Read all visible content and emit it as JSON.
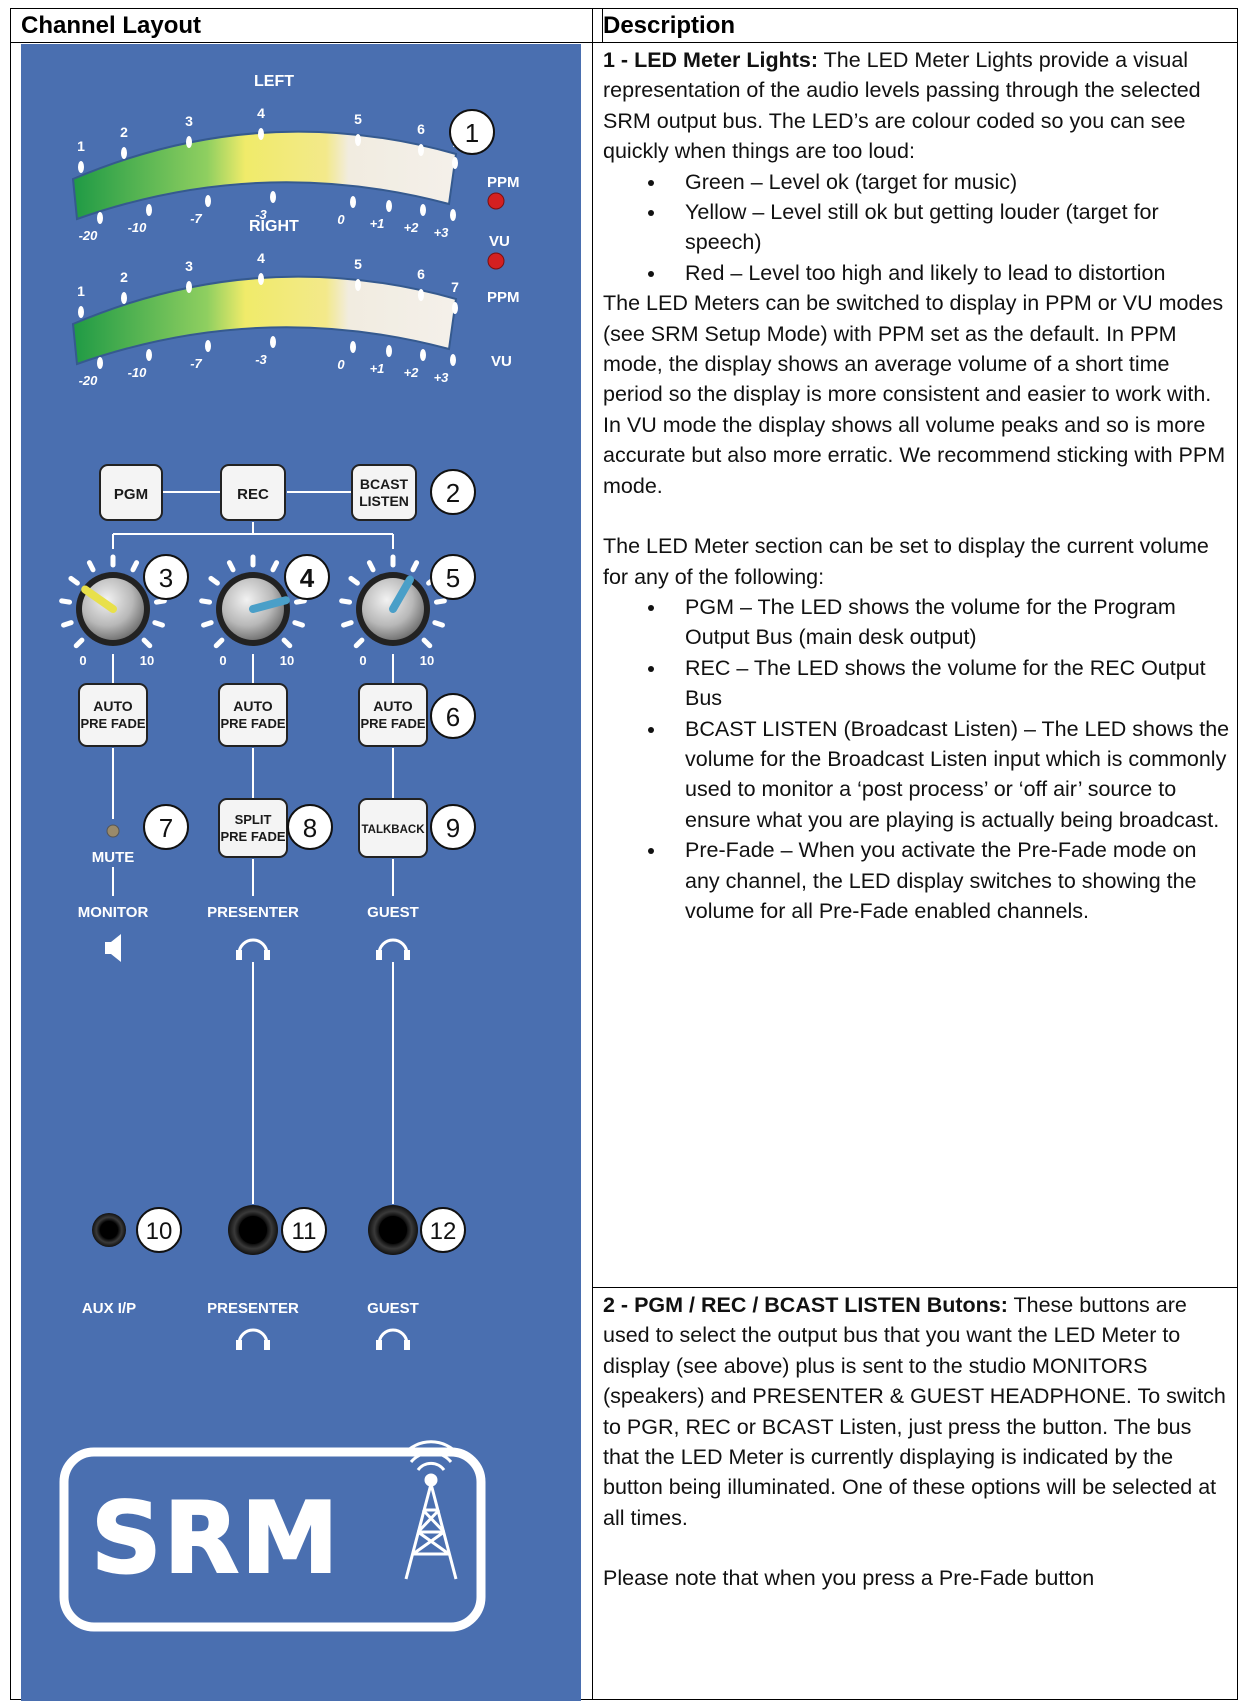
{
  "header": {
    "left": "Channel Layout",
    "right": "Description"
  },
  "panel": {
    "meter": {
      "left_label": "LEFT",
      "right_label": "RIGHT",
      "ppm_scale": [
        "1",
        "2",
        "3",
        "4",
        "5",
        "6",
        "7"
      ],
      "vu_scale": [
        "-20",
        "-10",
        "-7",
        "-3",
        "0",
        "+1",
        "+2",
        "+3"
      ],
      "ppm": "PPM",
      "vu": "VU"
    },
    "callouts": [
      "1",
      "2",
      "3",
      "4",
      "5",
      "6",
      "7",
      "8",
      "9",
      "10",
      "11",
      "12"
    ],
    "bus_buttons": [
      "PGM",
      "REC",
      "BCAST",
      "LISTEN"
    ],
    "knob_scale": {
      "min": "0",
      "max": "10"
    },
    "auto_btn": [
      "AUTO",
      "PRE FADE"
    ],
    "split_btn": [
      "SPLIT",
      "PRE FADE"
    ],
    "talkback": "TALKBACK",
    "mute": "MUTE",
    "outputs": [
      "MONITOR",
      "PRESENTER",
      "GUEST"
    ],
    "jacks": [
      "AUX I/P",
      "PRESENTER",
      "GUEST"
    ],
    "logo": "SRM",
    "colors": {
      "panel": "#4a6fb0",
      "meter_green": "#2fa84a",
      "meter_yellow": "#e8e04a",
      "led_red": "#d42020"
    }
  },
  "desc": {
    "s1_title": "1 - LED Meter Lights:",
    "s1_intro": " The LED Meter Lights provide a visual representation of the audio levels passing through the selected SRM output bus. The LED’s are colour coded so you can see quickly when things are too loud:",
    "s1_bullets": [
      "Green – Level ok (target for music)",
      "Yellow – Level still ok but getting louder (target for speech)",
      "Red – Level too high and likely to lead to distortion"
    ],
    "s1_para2": "The LED Meters can be switched to display in PPM or VU modes (see SRM Setup Mode) with PPM set as the default. In PPM mode, the display shows an average volume of a short time period so the display is more consistent and easier to work with. In VU mode the display shows all volume peaks and so is more accurate but also more erratic. We recommend sticking with PPM mode.",
    "s1_para3": "The LED Meter section can be set to display the current volume for any of the following:",
    "s1_bullets2": [
      "PGM – The LED shows the volume for the Program Output Bus (main desk output)",
      "REC – The LED shows the volume for the REC Output Bus",
      "BCAST LISTEN (Broadcast Listen) – The LED shows the volume for the Broadcast Listen input which is commonly used to monitor a ‘post process’ or ‘off air’ source to ensure what you are playing is actually being broadcast.",
      "Pre-Fade – When you activate the Pre-Fade mode on any channel, the LED display switches to showing the volume for all Pre-Fade enabled channels."
    ],
    "s2_title": "2 - PGM / REC / BCAST LISTEN Butons:",
    "s2_para1": " These buttons are used to select the output bus that you want the LED Meter to display (see above) plus is sent to the studio MONITORS (speakers) and PRESENTER & GUEST HEADPHONE. To switch to PGR, REC or BCAST Listen, just press the button. The bus that the LED Meter is currently displaying is indicated by the button being illuminated. One of these options will be selected at all times.",
    "s2_para2": "Please note that when you press a Pre-Fade button"
  }
}
